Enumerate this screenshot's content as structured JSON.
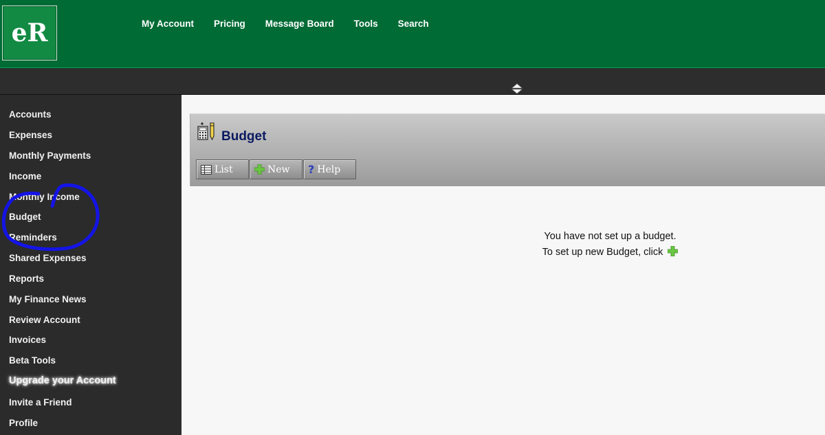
{
  "header": {
    "logo_text": "eR",
    "nav": [
      "My Account",
      "Pricing",
      "Message Board",
      "Tools",
      "Search"
    ]
  },
  "sidebar": {
    "items": [
      "Accounts",
      "Expenses",
      "Monthly Payments",
      "Income",
      "Monthly Income",
      "Budget",
      "Reminders",
      "Shared Expenses",
      "Reports",
      "My Finance News",
      "Review Account",
      "Invoices",
      "Beta Tools",
      "Upgrade your Account",
      "Invite a Friend",
      "Profile"
    ]
  },
  "page": {
    "title": "Budget",
    "toolbar": {
      "list": "List",
      "new": "New",
      "help": "Help"
    },
    "message_line1": "You have not set up a budget.",
    "message_line2": "To set up new Budget, click"
  },
  "colors": {
    "header_green": "#006b35",
    "sidebar_bg": "#2b2b2b",
    "title_navy": "#0a1a60",
    "plus_green": "#6cc644",
    "annotation_blue": "#1414e6"
  }
}
